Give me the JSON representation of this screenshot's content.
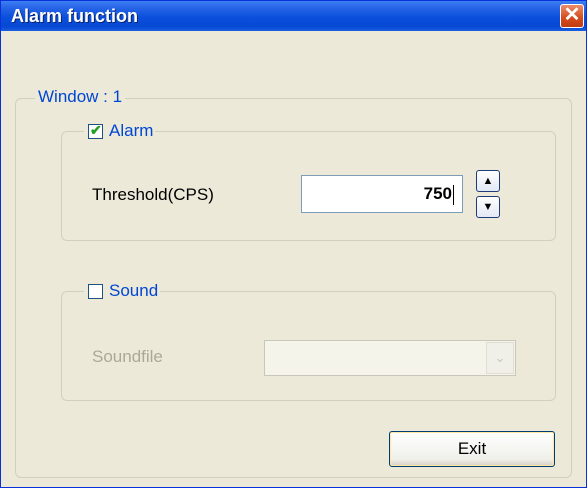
{
  "window": {
    "title": "Alarm function",
    "close_glyph": "✕"
  },
  "groups": {
    "outer_label": "Window : 1",
    "alarm": {
      "label": "Alarm",
      "checked": true,
      "check_glyph": "✔"
    },
    "sound": {
      "label": "Sound",
      "checked": false
    }
  },
  "threshold": {
    "label": "Threshold(CPS)",
    "value": "750"
  },
  "spin": {
    "up_glyph": "▲",
    "down_glyph": "▼"
  },
  "soundfile": {
    "label": "Soundfile",
    "value": "",
    "dropdown_glyph": "⌄"
  },
  "buttons": {
    "exit_label": "Exit"
  },
  "colors": {
    "accent": "#0046d5",
    "titlebar": "#0a4fdc",
    "dialog_bg": "#ece9d8",
    "close": "#d44c1e"
  },
  "icons": {
    "close": "close-icon",
    "checkmark": "checkmark-icon",
    "spin_up": "arrow-up-icon",
    "spin_down": "arrow-down-icon",
    "dropdown": "chevron-down-icon"
  }
}
